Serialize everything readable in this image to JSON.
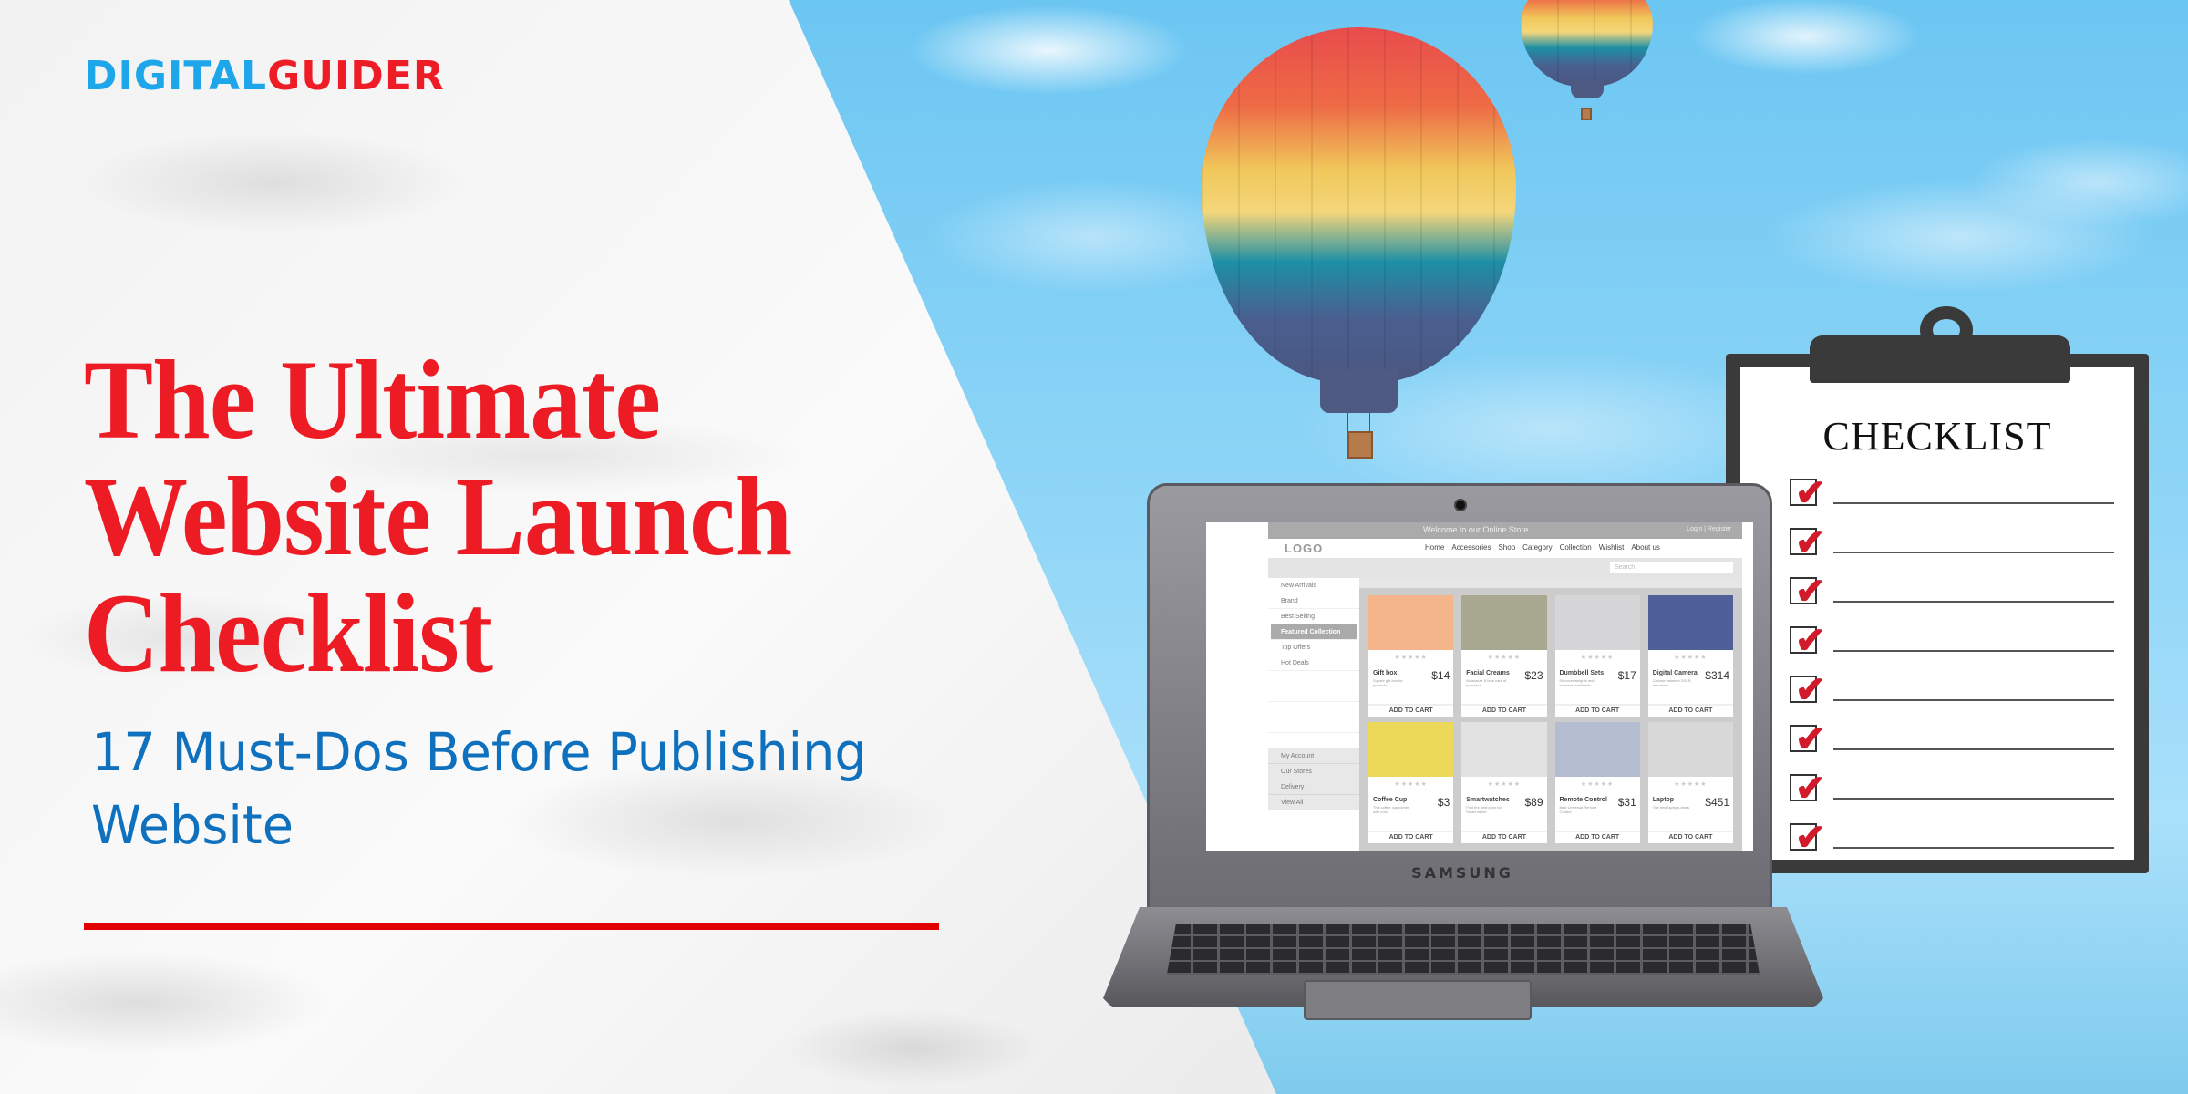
{
  "brand": {
    "part1": "DIGITAL",
    "part2": "GUIDER"
  },
  "headline": {
    "lines": [
      "The Ultimate",
      "Website Launch",
      "Checklist"
    ],
    "subtitle_lines": [
      "17 Must-Dos Before Publishing",
      "Website"
    ]
  },
  "colors": {
    "title_red": "#ed1c24",
    "subtitle_blue": "#0f71bd",
    "rule_red": "#e00000",
    "logo_blue": "#1ea6ea",
    "sky_blue": "#8ed5f7"
  },
  "laptop": {
    "brand": "SAMSUNG",
    "store": {
      "welcome": "Welcome to our Online Store",
      "login": "Login | Register",
      "logo": "LOGO",
      "nav": [
        "Home",
        "Accessories",
        "Shop",
        "Category",
        "Collection",
        "Wishlist",
        "About us"
      ],
      "search_placeholder": "Search",
      "sidebar_top": [
        "New Arrivals",
        "Brand",
        "Best Selling",
        "Featured Collection",
        "Top Offers",
        "Hot Deals"
      ],
      "sidebar_active": "Featured Collection",
      "sidebar_bottom": [
        "My Account",
        "Our Stores",
        "Delivery",
        "View All"
      ],
      "stars": "★★★★★",
      "cart_label": "ADD TO CART",
      "products": [
        {
          "name": "Gift box",
          "desc": "Square gift box for products",
          "price": "$14",
          "color": "#f4b58a"
        },
        {
          "name": "Facial Creams",
          "desc": "Moisturize & take care of your face",
          "price": "$23",
          "color": "#a8a891"
        },
        {
          "name": "Dumbbell Sets",
          "desc": "Discover weights and exercise dumbbells",
          "price": "$17",
          "color": "#d6d6d8"
        },
        {
          "name": "Digital Camera",
          "desc": "Choose between DSLR, mirrorless",
          "price": "$314",
          "color": "#4f6098"
        },
        {
          "name": "Coffee Cup",
          "desc": "This coffee cup comes with a lid",
          "price": "$3",
          "color": "#ecd95a"
        },
        {
          "name": "Smartwatches",
          "desc": "Find the best price for Smart watch",
          "price": "$89",
          "color": "#e2e2e2"
        },
        {
          "name": "Remote Control",
          "desc": "Best Universal Remote Control",
          "price": "$31",
          "color": "#b4bcd0"
        },
        {
          "name": "Laptop",
          "desc": "The best laptops deals",
          "price": "$451",
          "color": "#d8d8d8"
        }
      ]
    }
  },
  "clipboard": {
    "title": "CHECKLIST",
    "checked_items": 8,
    "tick": "✔"
  }
}
